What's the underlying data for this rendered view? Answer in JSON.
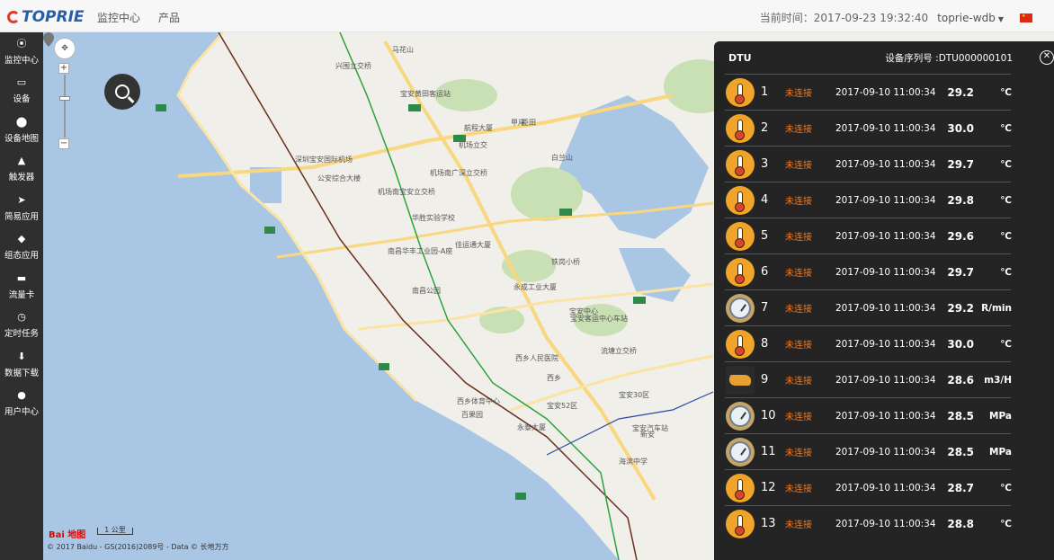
{
  "app": {
    "logo_text": "TOPRIE",
    "nav": [
      "监控中心",
      "产品"
    ],
    "time_label": "当前时间：2017-09-23 19:32:40",
    "user": "toprie-wdb"
  },
  "sidebar": {
    "items": [
      {
        "label": "监控中心",
        "icon": "target-icon",
        "glyph": "⦿"
      },
      {
        "label": "设备",
        "icon": "monitor-icon",
        "glyph": "▭"
      },
      {
        "label": "设备地图",
        "icon": "map-pin-icon",
        "glyph": "⬤"
      },
      {
        "label": "触发器",
        "icon": "bell-icon",
        "glyph": "▲"
      },
      {
        "label": "简易应用",
        "icon": "send-icon",
        "glyph": "➤"
      },
      {
        "label": "组态应用",
        "icon": "puzzle-icon",
        "glyph": "◆"
      },
      {
        "label": "流量卡",
        "icon": "card-icon",
        "glyph": "▬"
      },
      {
        "label": "定时任务",
        "icon": "clock-icon",
        "glyph": "◷"
      },
      {
        "label": "数据下载",
        "icon": "download-icon",
        "glyph": "⬇"
      },
      {
        "label": "用户中心",
        "icon": "user-icon",
        "glyph": "●"
      }
    ]
  },
  "map": {
    "scale_label": "1 公里",
    "baidu_logo": "Bai 地图",
    "copyright": "© 2017 Baidu - GS(2016)2089号 - Data © 长地万方",
    "labels": [
      {
        "text": "马花山"
      },
      {
        "text": "兴围立交桥"
      },
      {
        "text": "宝安黄田客运站"
      },
      {
        "text": "深圳宝安国际机场"
      },
      {
        "text": "公安综合大楼"
      },
      {
        "text": "机场南广深立交桥"
      },
      {
        "text": "机场南宝安立交桥"
      },
      {
        "text": "华胜实验学校"
      },
      {
        "text": "佳运通大厦"
      },
      {
        "text": "南昌华丰工业园-A座"
      },
      {
        "text": "永成工业大厦"
      },
      {
        "text": "南昌公园"
      },
      {
        "text": "西乡人民医院"
      },
      {
        "text": "流塘立交桥"
      },
      {
        "text": "宝安中心"
      },
      {
        "text": "海滨中学"
      },
      {
        "text": "铁岗小桥"
      },
      {
        "text": "西乡"
      },
      {
        "text": "新安"
      },
      {
        "text": "百果园"
      },
      {
        "text": "宝安30区"
      },
      {
        "text": "宝安52区"
      },
      {
        "text": "永泰大厦"
      },
      {
        "text": "甲岸"
      },
      {
        "text": "西乡体育中心"
      },
      {
        "text": "宝安汽车站"
      },
      {
        "text": "航程大厦"
      },
      {
        "text": "机场立交"
      },
      {
        "text": "臣田"
      },
      {
        "text": "白兰山"
      },
      {
        "text": "宝安客运中心车站"
      }
    ]
  },
  "dtu": {
    "title": "DTU",
    "serial": "设备序列号 :DTU000000101",
    "rows": [
      {
        "num": "1",
        "status": "未连接",
        "time": "2017-09-10 11:00:34",
        "value": "29.2",
        "unit": "℃",
        "icon": "thermometer-icon"
      },
      {
        "num": "2",
        "status": "未连接",
        "time": "2017-09-10 11:00:34",
        "value": "30.0",
        "unit": "℃",
        "icon": "thermometer-icon"
      },
      {
        "num": "3",
        "status": "未连接",
        "time": "2017-09-10 11:00:34",
        "value": "29.7",
        "unit": "℃",
        "icon": "thermometer-icon"
      },
      {
        "num": "4",
        "status": "未连接",
        "time": "2017-09-10 11:00:34",
        "value": "29.8",
        "unit": "℃",
        "icon": "thermometer-icon"
      },
      {
        "num": "5",
        "status": "未连接",
        "time": "2017-09-10 11:00:34",
        "value": "29.6",
        "unit": "℃",
        "icon": "thermometer-icon"
      },
      {
        "num": "6",
        "status": "未连接",
        "time": "2017-09-10 11:00:34",
        "value": "29.7",
        "unit": "℃",
        "icon": "thermometer-icon"
      },
      {
        "num": "7",
        "status": "未连接",
        "time": "2017-09-10 11:00:34",
        "value": "29.2",
        "unit": "R/min",
        "icon": "gauge-icon"
      },
      {
        "num": "8",
        "status": "未连接",
        "time": "2017-09-10 11:00:34",
        "value": "30.0",
        "unit": "℃",
        "icon": "thermometer-icon"
      },
      {
        "num": "9",
        "status": "未连接",
        "time": "2017-09-10 11:00:34",
        "value": "28.6",
        "unit": "m3/H",
        "icon": "flow-icon"
      },
      {
        "num": "10",
        "status": "未连接",
        "time": "2017-09-10 11:00:34",
        "value": "28.5",
        "unit": "MPa",
        "icon": "gauge-icon"
      },
      {
        "num": "11",
        "status": "未连接",
        "time": "2017-09-10 11:00:34",
        "value": "28.5",
        "unit": "MPa",
        "icon": "gauge-icon"
      },
      {
        "num": "12",
        "status": "未连接",
        "time": "2017-09-10 11:00:34",
        "value": "28.7",
        "unit": "℃",
        "icon": "thermometer-icon"
      },
      {
        "num": "13",
        "status": "未连接",
        "time": "2017-09-10 11:00:34",
        "value": "28.8",
        "unit": "℃",
        "icon": "thermometer-icon"
      }
    ]
  }
}
